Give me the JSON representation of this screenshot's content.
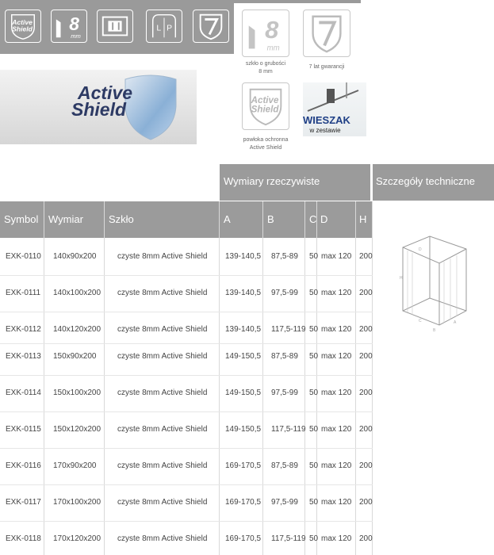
{
  "features_top": {
    "icons": [
      "active-shield-icon",
      "glass-8mm-icon",
      "hanger-icon",
      "lp-icon",
      "warranty-shield-icon"
    ],
    "active_shield_line1": "Active",
    "active_shield_line2": "Shield",
    "glass_num": "8",
    "glass_unit": "mm",
    "lp_l": "L",
    "lp_p": "P"
  },
  "banner": {
    "line1": "Active",
    "line2": "Shield"
  },
  "features_right": {
    "glass": {
      "num": "8",
      "unit": "mm",
      "caption1": "szkło o grubości",
      "caption2": "8 mm"
    },
    "warranty": {
      "caption": "7 lat gwarancji"
    },
    "coating": {
      "line1": "Active",
      "line2": "Shield",
      "caption1": "powłoka ochronna",
      "caption2": "Active Shield"
    },
    "hanger": {
      "title": "WIESZAK",
      "subtitle": "w zestawie"
    }
  },
  "table": {
    "group_header": "Wymiary rzeczywiste",
    "tech_header": "Szczegóły techniczne",
    "columns": [
      "Symbol",
      "Wymiar",
      "Szkło",
      "A",
      "B",
      "C",
      "D",
      "H"
    ],
    "rows": [
      [
        "EXK-0110",
        "140x90x200",
        "czyste 8mm Active Shield",
        "139-140,5",
        "87,5-89",
        "50",
        "max 120",
        "200"
      ],
      [
        "EXK-0111",
        "140x100x200",
        "czyste 8mm Active Shield",
        "139-140,5",
        "97,5-99",
        "50",
        "max 120",
        "200"
      ],
      [
        "EXK-0112",
        "140x120x200",
        "czyste 8mm Active Shield",
        "139-140,5",
        "117,5-119",
        "50",
        "max 120",
        "200"
      ],
      [
        "EXK-0113",
        "150x90x200",
        "czyste 8mm Active Shield",
        "149-150,5",
        "87,5-89",
        "50",
        "max 120",
        "200"
      ],
      [
        "EXK-0114",
        "150x100x200",
        "czyste 8mm Active Shield",
        "149-150,5",
        "97,5-99",
        "50",
        "max 120",
        "200"
      ],
      [
        "EXK-0115",
        "150x120x200",
        "czyste 8mm Active Shield",
        "149-150,5",
        "117,5-119",
        "50",
        "max 120",
        "200"
      ],
      [
        "EXK-0116",
        "170x90x200",
        "czyste 8mm Active Shield",
        "169-170,5",
        "87,5-89",
        "50",
        "max 120",
        "200"
      ],
      [
        "EXK-0117",
        "170x100x200",
        "czyste 8mm Active Shield",
        "169-170,5",
        "97,5-99",
        "50",
        "max 120",
        "200"
      ],
      [
        "EXK-0118",
        "170x120x200",
        "czyste 8mm Active Shield",
        "169-170,5",
        "117,5-119",
        "50",
        "max 120",
        "200"
      ]
    ]
  }
}
